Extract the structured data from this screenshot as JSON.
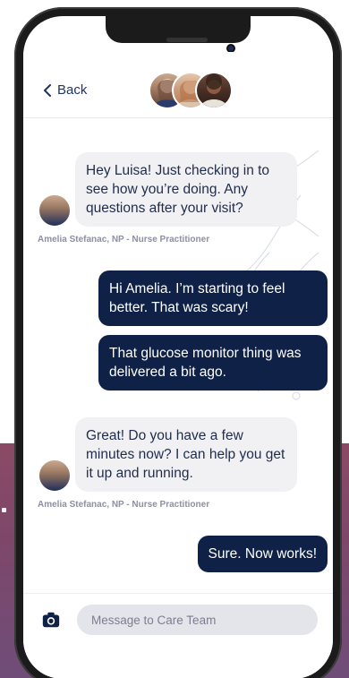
{
  "colors": {
    "accent": "#0f2146",
    "incoming_bubble": "#f1f1f4",
    "background_band": "#7e476a"
  },
  "header": {
    "back_label": "Back",
    "back_icon": "chevron-left-icon",
    "care_team_avatars": [
      "care-team-member-1",
      "care-team-member-2",
      "care-team-member-3"
    ]
  },
  "messages": [
    {
      "direction": "incoming",
      "text": "Hey Luisa! Just checking in to see how you’re doing. Any questions after your visit?",
      "author": "Amelia Stefanac, NP - Nurse Practitioner"
    },
    {
      "direction": "outgoing",
      "text": "Hi Amelia. I’m starting to feel better. That was scary!"
    },
    {
      "direction": "outgoing",
      "text": "That glucose monitor thing was delivered a bit ago."
    },
    {
      "direction": "incoming",
      "text": "Great! Do you have a few minutes now? I can help you get it up and running.",
      "author": "Amelia Stefanac, NP - Nurse Practitioner"
    },
    {
      "direction": "outgoing",
      "text": "Sure. Now works!"
    }
  ],
  "composer": {
    "placeholder": "Message to Care Team",
    "camera_icon": "camera-icon"
  }
}
